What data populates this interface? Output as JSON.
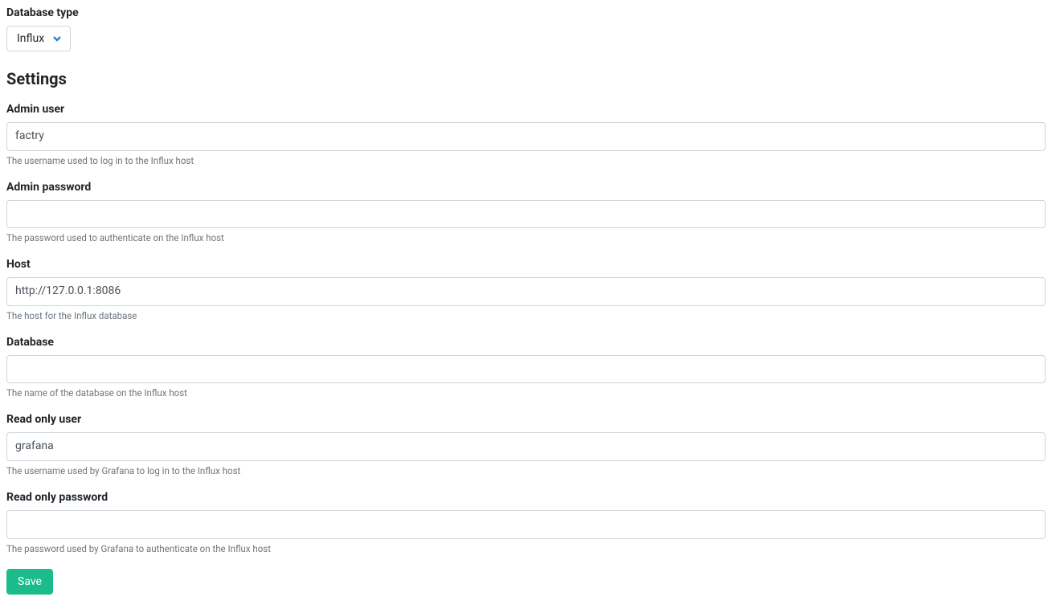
{
  "database_type": {
    "label": "Database type",
    "selected": "Influx"
  },
  "settings_heading": "Settings",
  "fields": {
    "admin_user": {
      "label": "Admin user",
      "value": "factry",
      "help": "The username used to log in to the Influx host"
    },
    "admin_password": {
      "label": "Admin password",
      "value": "",
      "help": "The password used to authenticate on the Influx host"
    },
    "host": {
      "label": "Host",
      "value": "http://127.0.0.1:8086",
      "help": "The host for the Influx database"
    },
    "database": {
      "label": "Database",
      "value": "",
      "help": "The name of the database on the Influx host"
    },
    "read_only_user": {
      "label": "Read only user",
      "value": "grafana",
      "help": "The username used by Grafana to log in to the Influx host"
    },
    "read_only_password": {
      "label": "Read only password",
      "value": "",
      "help": "The password used by Grafana to authenticate on the Influx host"
    }
  },
  "save_label": "Save"
}
